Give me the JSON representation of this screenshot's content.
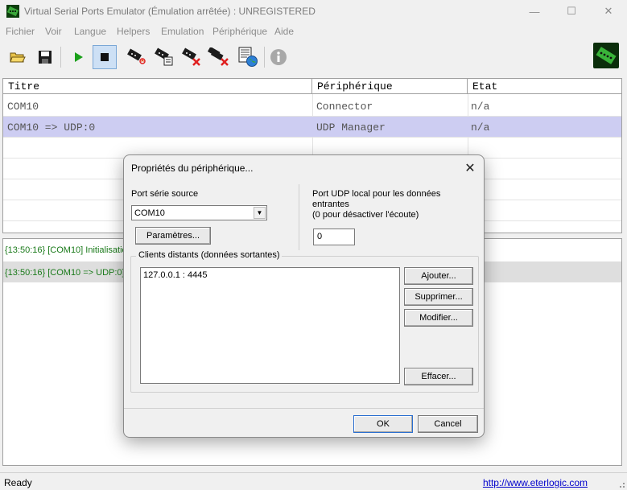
{
  "window": {
    "title": "Virtual Serial Ports Emulator (Émulation arrêtée) : UNREGISTERED",
    "min_glyph": "—",
    "max_glyph": "☐",
    "close_glyph": "✕"
  },
  "menu": [
    "Fichier",
    "Voir",
    "Langue",
    "Helpers",
    "Emulation",
    "Périphérique",
    "Aide"
  ],
  "toolbar": {
    "buttons": [
      "open-folder-icon",
      "save-icon",
      "play-icon",
      "stop-icon",
      "new-device-icon",
      "device-properties-icon",
      "delete-device-icon",
      "delete-all-devices-icon",
      "web-export-icon",
      "info-icon"
    ],
    "active": "stop-icon"
  },
  "devices": {
    "columns": [
      "Titre",
      "Périphérique",
      "Etat"
    ],
    "rows": [
      {
        "title": "COM10",
        "device": "Connector",
        "state": "n/a"
      },
      {
        "title": "COM10 => UDP:0",
        "device": "UDP Manager",
        "state": "n/a"
      }
    ],
    "selected_row": 1
  },
  "log": [
    "{13:50:16} [COM10] Initialisation...",
    "{13:50:16} [COM10 => UDP:0] Initialisation..."
  ],
  "status": {
    "text": "Ready",
    "link": "http://www.eterlogic.com"
  },
  "dialog": {
    "title": "Propriétés du périphérique...",
    "close_glyph": "✕",
    "source_port_label": "Port série source",
    "source_port_value": "COM10",
    "params_button": "Paramètres...",
    "udp_label_line1": "Port UDP local pour les données",
    "udp_label_line2": "entrantes",
    "udp_label_line3": "(0 pour désactiver l'écoute)",
    "udp_port_value": "0",
    "clients_group_label": "Clients distants (données sortantes)",
    "clients": [
      "127.0.0.1 : 4445"
    ],
    "add_button": "Ajouter...",
    "remove_button": "Supprimer...",
    "edit_button": "Modifier...",
    "clear_button": "Effacer...",
    "ok_button": "OK",
    "cancel_button": "Cancel"
  },
  "colors": {
    "selection": "#cdcdf2",
    "log_text": "#1a7a1a",
    "link": "#0000cc",
    "play_green": "#1aa01a",
    "delete_red": "#e02020"
  }
}
